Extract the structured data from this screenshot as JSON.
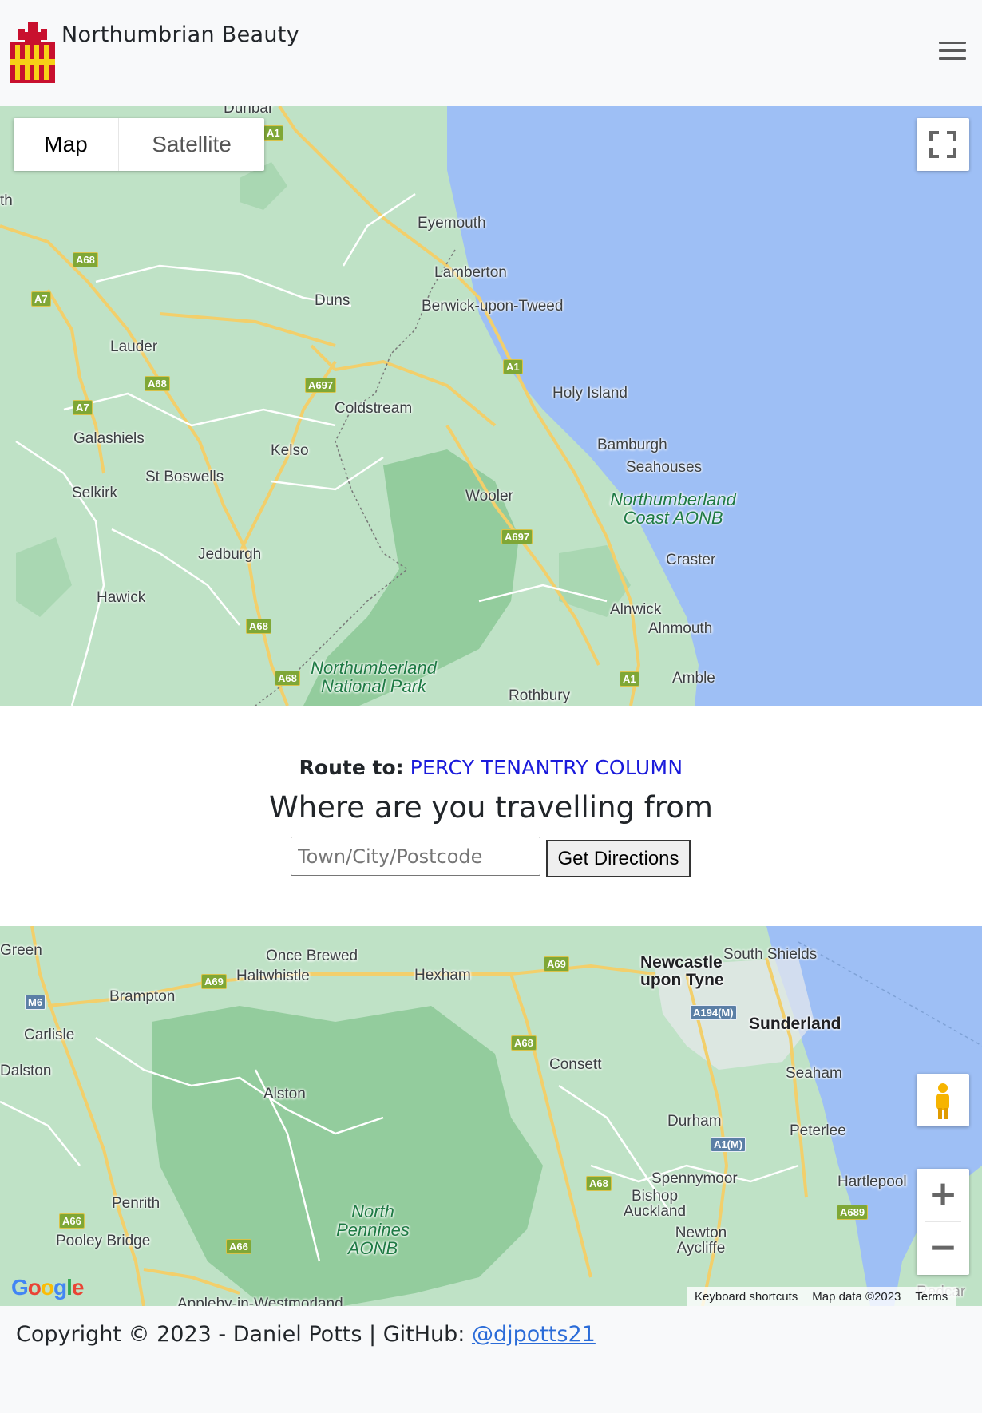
{
  "navbar": {
    "brand_name": "Northumbrian Beauty",
    "logo_icon": "northumberland-flag-castle-icon",
    "menu_icon": "hamburger-menu-icon",
    "logo_colors": [
      "#c8102e",
      "#f7d117"
    ]
  },
  "map_top": {
    "type_control": {
      "map_label": "Map",
      "satellite_label": "Satellite",
      "selected": "Map"
    },
    "fullscreen_icon": "fullscreen-icon",
    "place_labels": [
      "Dunbar",
      "Eyemouth",
      "Lamberton",
      "Duns",
      "Berwick-upon-Tweed",
      "Lauder",
      "Coldstream",
      "Holy Island",
      "Galashiels",
      "Kelso",
      "Bamburgh",
      "Seahouses",
      "St Boswells",
      "Selkirk",
      "Wooler",
      "Craster",
      "Jedburgh",
      "Hawick",
      "Alnwick",
      "Alnmouth",
      "Amble",
      "Rothbury",
      "th"
    ],
    "park_labels": [
      "Northumberland Coast AONB",
      "Northumberland National Park"
    ],
    "road_shields": [
      "A1",
      "A68",
      "A7",
      "A68",
      "A697",
      "A7",
      "A1",
      "A697",
      "A68",
      "A68",
      "A1"
    ]
  },
  "route": {
    "prefix": "Route to:",
    "destination": "PERCY TENANTRY COLUMN",
    "heading": "Where are you travelling from",
    "input_placeholder": "Town/City/Postcode",
    "input_value": "",
    "button_label": "Get Directions"
  },
  "map_bottom": {
    "place_labels": [
      "Green",
      "Once Brewed",
      "Haltwhistle",
      "Hexham",
      "Newcastle upon Tyne",
      "South Shields",
      "Brampton",
      "Carlisle",
      "Sunderland",
      "Consett",
      "Dalston",
      "Seaham",
      "Alston",
      "Durham",
      "Peterlee",
      "Spennymoor",
      "Hartlepool",
      "Bishop Auckland",
      "Penrith",
      "Pooley Bridge",
      "Newton Aycliffe",
      "Appleby-in-Westmorland",
      "Redcar"
    ],
    "park_labels": [
      "North Pennines AONB"
    ],
    "road_shields": [
      "A69",
      "A69",
      "M6",
      "A194(M)",
      "A68",
      "A1(M)",
      "A68",
      "A66",
      "A66",
      "A689"
    ],
    "pegman_icon": "street-view-pegman-icon",
    "zoom_in_icon": "zoom-in-icon",
    "zoom_out_icon": "zoom-out-icon",
    "attribution": {
      "keyboard": "Keyboard shortcuts",
      "data": "Map data ©2023",
      "terms": "Terms"
    },
    "google_logo": "Google"
  },
  "footer": {
    "copyright": "Copyright © 2023 - Daniel Potts | GitHub: ",
    "github_link": "@djpotts21"
  },
  "colors": {
    "water": "#9ebff5",
    "land": "#bfe2c6",
    "park": "#93cc9d",
    "road": "#f2cf6b",
    "link": "#2b6cd8",
    "destination": "#1a1adb"
  }
}
